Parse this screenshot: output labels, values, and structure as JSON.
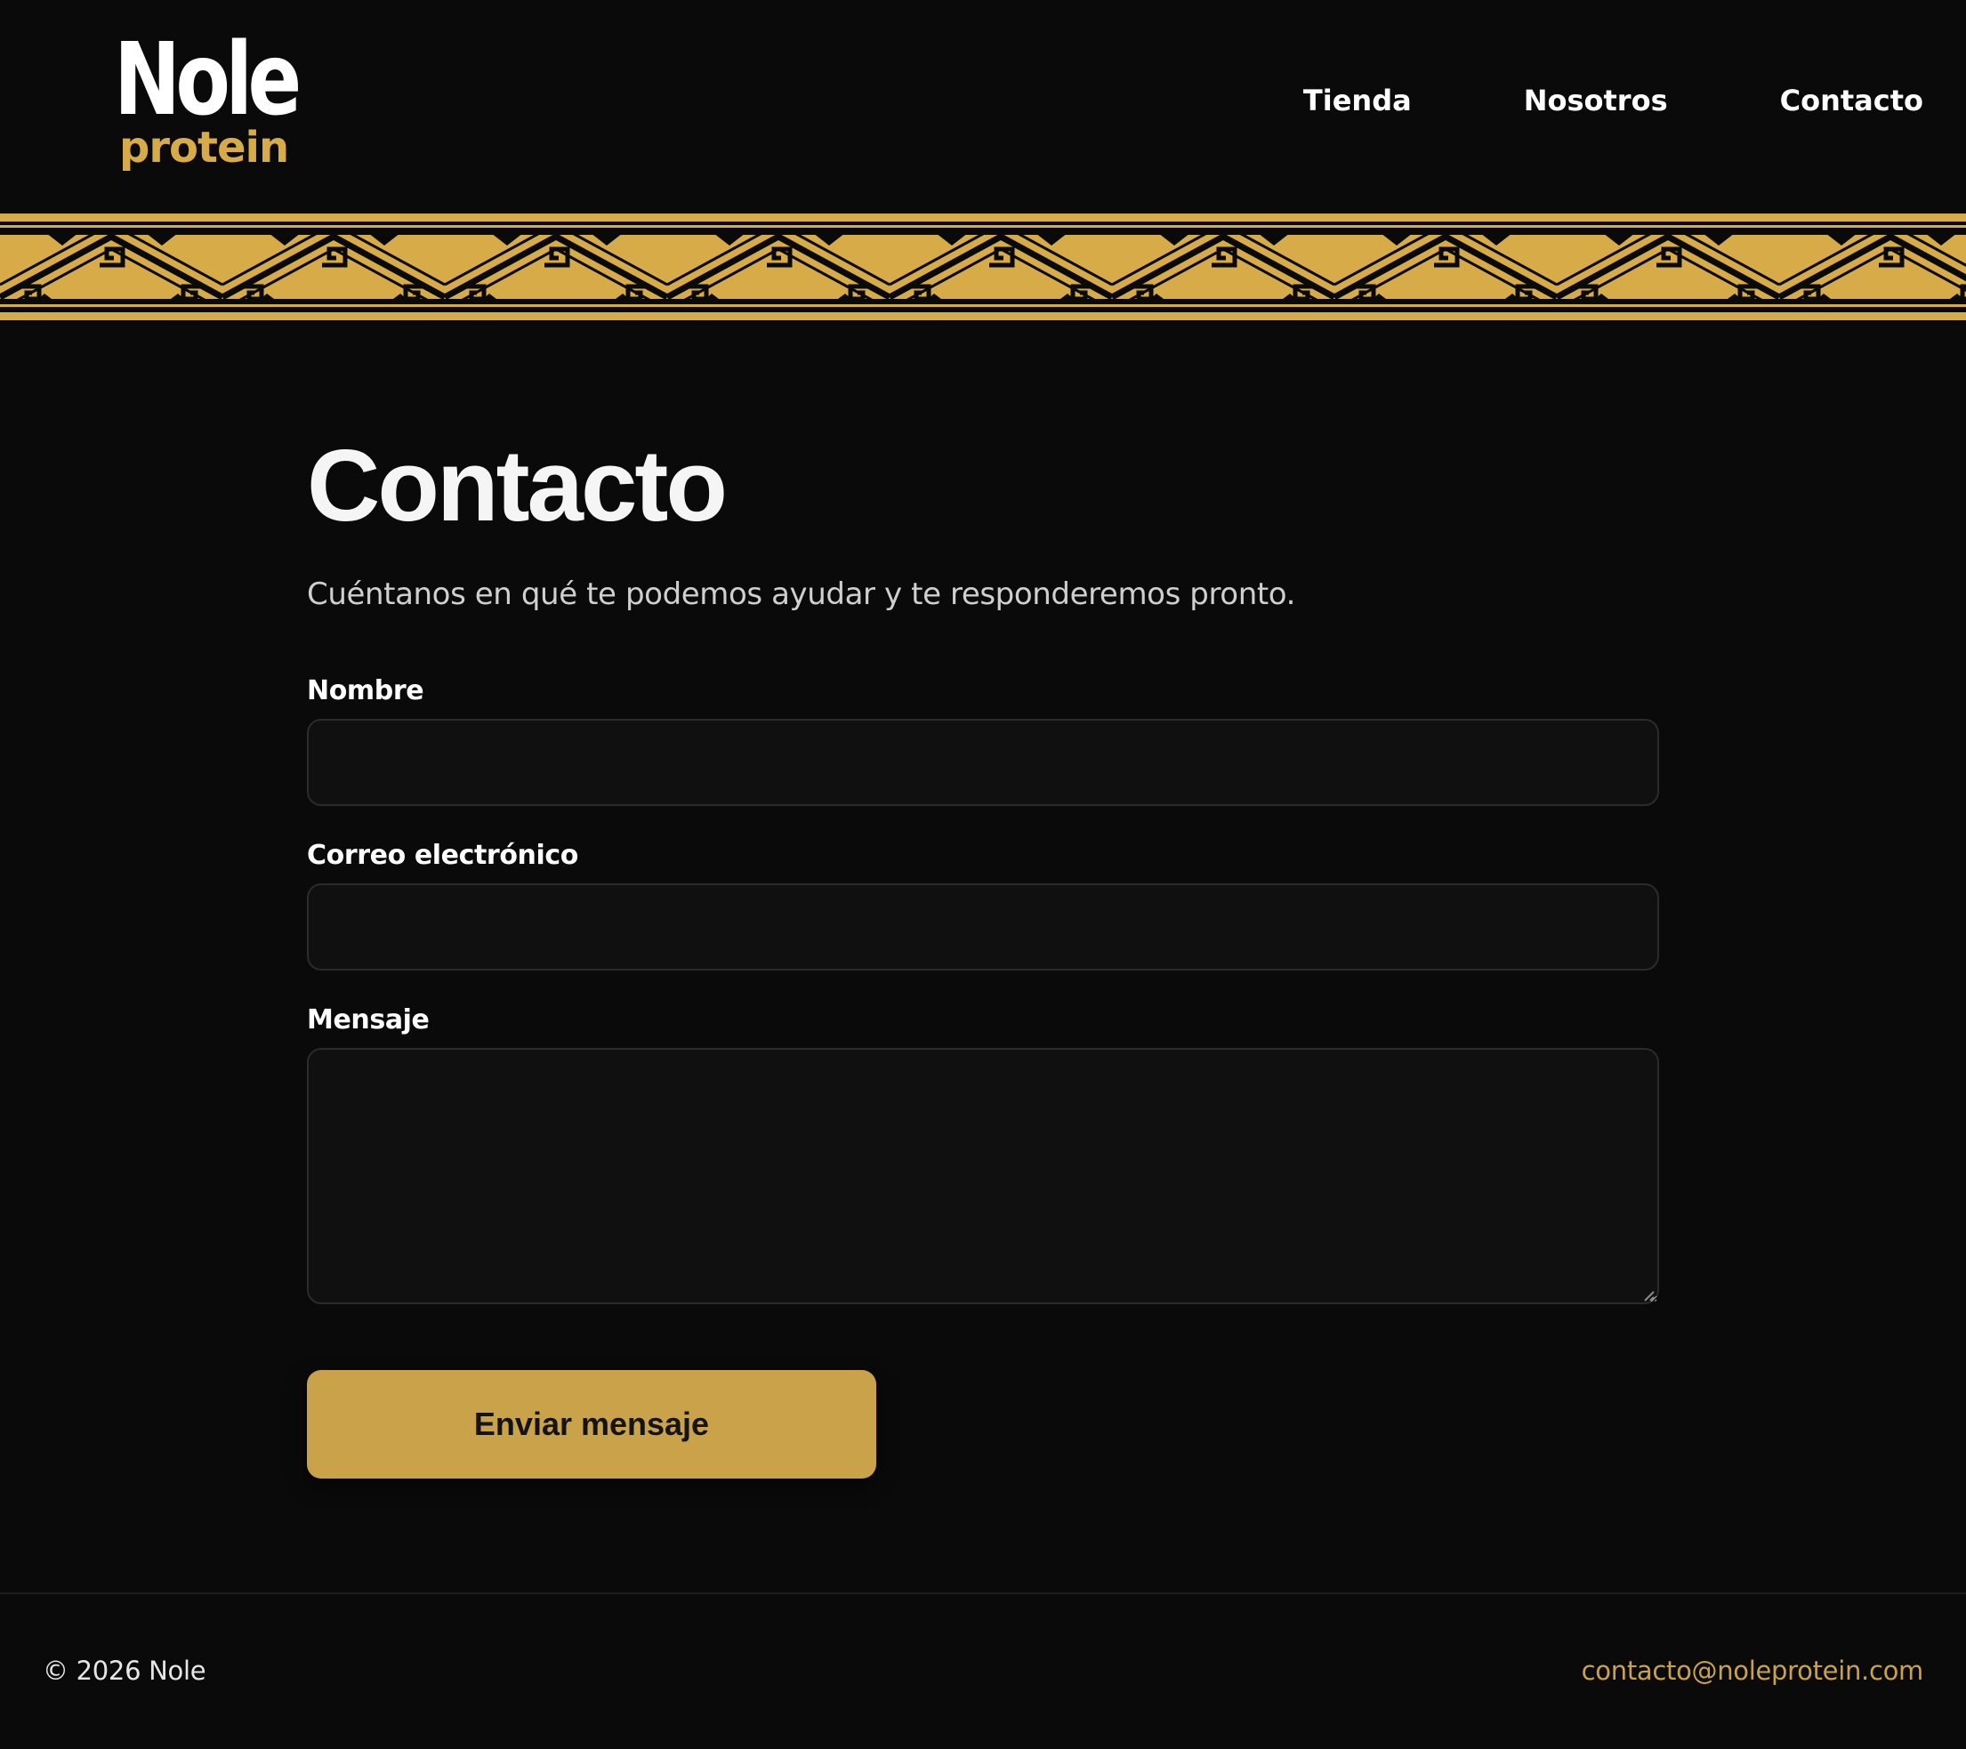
{
  "brand": {
    "logo_word": "Nole",
    "logo_sub": "protein",
    "gold": "#d7ab47",
    "background": "#0a0a0a"
  },
  "nav": {
    "items": [
      "Tienda",
      "Nosotros",
      "Contacto"
    ]
  },
  "page": {
    "title": "Contacto",
    "subtitle": "Cuéntanos en qué te podemos ayudar y te responderemos pronto."
  },
  "form": {
    "name": {
      "label": "Nombre",
      "value": ""
    },
    "email": {
      "label": "Correo electrónico",
      "value": ""
    },
    "message": {
      "label": "Mensaje",
      "value": ""
    },
    "submit_label": "Enviar mensaje",
    "button_color": "#c9a24a"
  },
  "footer": {
    "copyright": "© 2026 Nole",
    "email": "contacto@noleprotein.com"
  }
}
